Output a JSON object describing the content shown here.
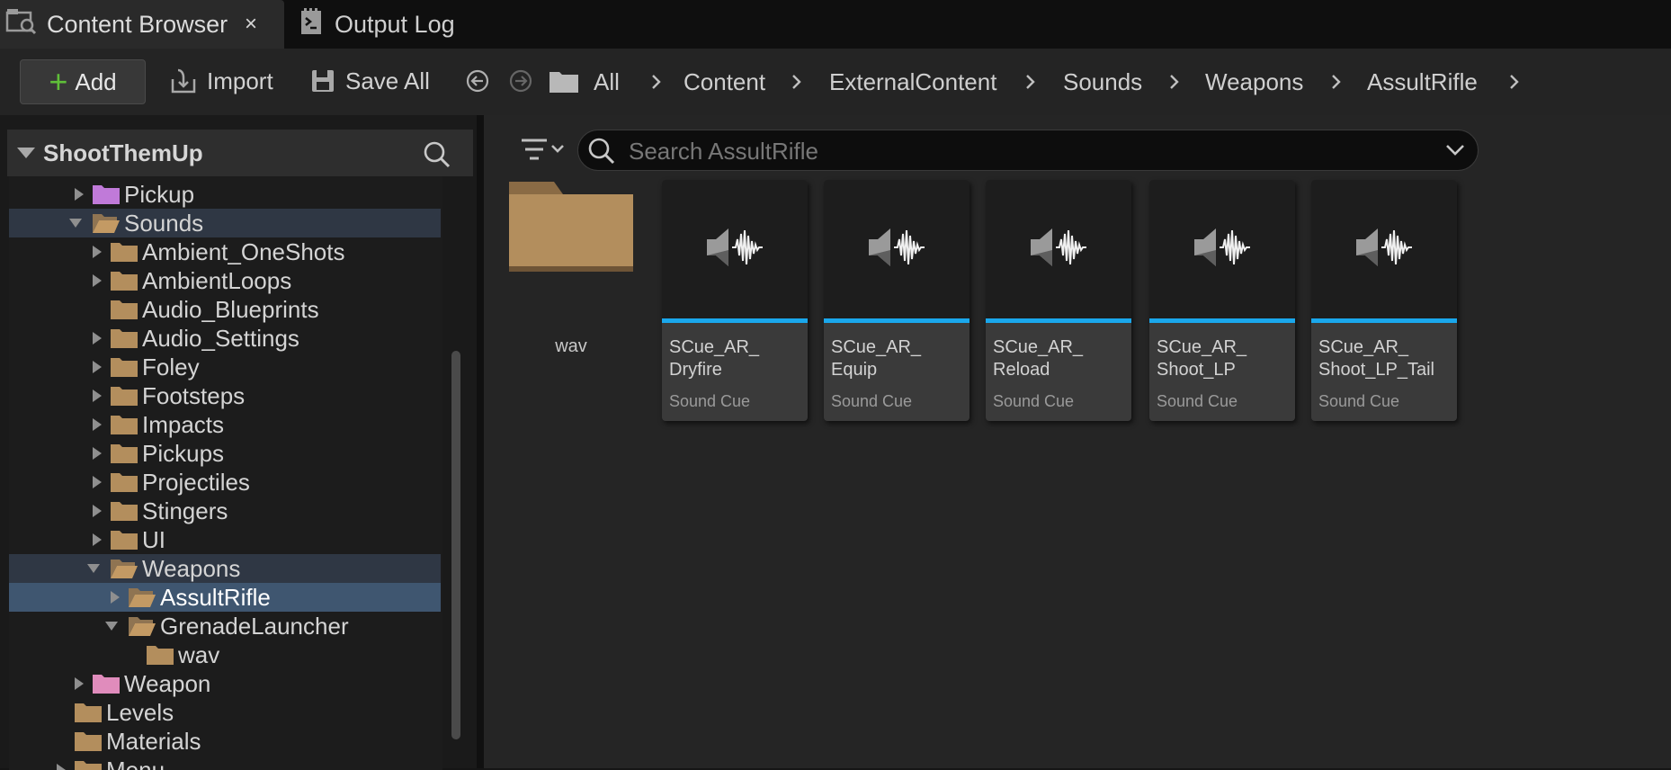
{
  "tabs": [
    {
      "label": "Content Browser",
      "icon": "content-browser-icon",
      "active": true,
      "close": "×"
    },
    {
      "label": "Output Log",
      "icon": "output-log-icon",
      "active": false
    }
  ],
  "toolbar": {
    "add_label": "Add",
    "import_label": "Import",
    "saveall_label": "Save All"
  },
  "breadcrumb": [
    "All",
    "Content",
    "ExternalContent",
    "Sounds",
    "Weapons",
    "AssultRifle"
  ],
  "tree": {
    "root": "ShootThemUp",
    "items": [
      {
        "label": "Pickup",
        "color": "#c07ad9",
        "expanded": false
      },
      {
        "label": "Sounds",
        "color": "#b38e5d",
        "expanded": true
      },
      {
        "label": "Ambient_OneShots",
        "color": "#b38e5d"
      },
      {
        "label": "AmbientLoops",
        "color": "#b38e5d"
      },
      {
        "label": "Audio_Blueprints",
        "color": "#b38e5d"
      },
      {
        "label": "Audio_Settings",
        "color": "#b38e5d"
      },
      {
        "label": "Foley",
        "color": "#b38e5d"
      },
      {
        "label": "Footsteps",
        "color": "#b38e5d"
      },
      {
        "label": "Impacts",
        "color": "#b38e5d"
      },
      {
        "label": "Pickups",
        "color": "#b38e5d"
      },
      {
        "label": "Projectiles",
        "color": "#b38e5d"
      },
      {
        "label": "Stingers",
        "color": "#b38e5d"
      },
      {
        "label": "UI",
        "color": "#b38e5d"
      },
      {
        "label": "Weapons",
        "color": "#b38e5d",
        "expanded": true
      },
      {
        "label": "AssultRifle",
        "color": "#b38e5d",
        "selected": true
      },
      {
        "label": "GrenadeLauncher",
        "color": "#b38e5d",
        "expanded": true
      },
      {
        "label": "wav",
        "color": "#b38e5d"
      },
      {
        "label": "Weapon",
        "color": "#e08cbc"
      },
      {
        "label": "Levels",
        "color": "#b38e5d"
      },
      {
        "label": "Materials",
        "color": "#b38e5d"
      },
      {
        "label": "Menu",
        "color": "#b38e5d"
      }
    ]
  },
  "search": {
    "placeholder": "Search AssultRifle"
  },
  "folder": {
    "label": "wav"
  },
  "assets": [
    {
      "name": "SCue_AR_\nDryfire",
      "type": "Sound Cue"
    },
    {
      "name": "SCue_AR_\nEquip",
      "type": "Sound Cue"
    },
    {
      "name": "SCue_AR_\nReload",
      "type": "Sound Cue"
    },
    {
      "name": "SCue_AR_\nShoot_LP",
      "type": "Sound Cue"
    },
    {
      "name": "SCue_AR_\nShoot_LP_Tail",
      "type": "Sound Cue"
    }
  ],
  "colors": {
    "accent": "#1aa7ec",
    "add_plus": "#5fbf39",
    "selection": "#3f5670"
  }
}
